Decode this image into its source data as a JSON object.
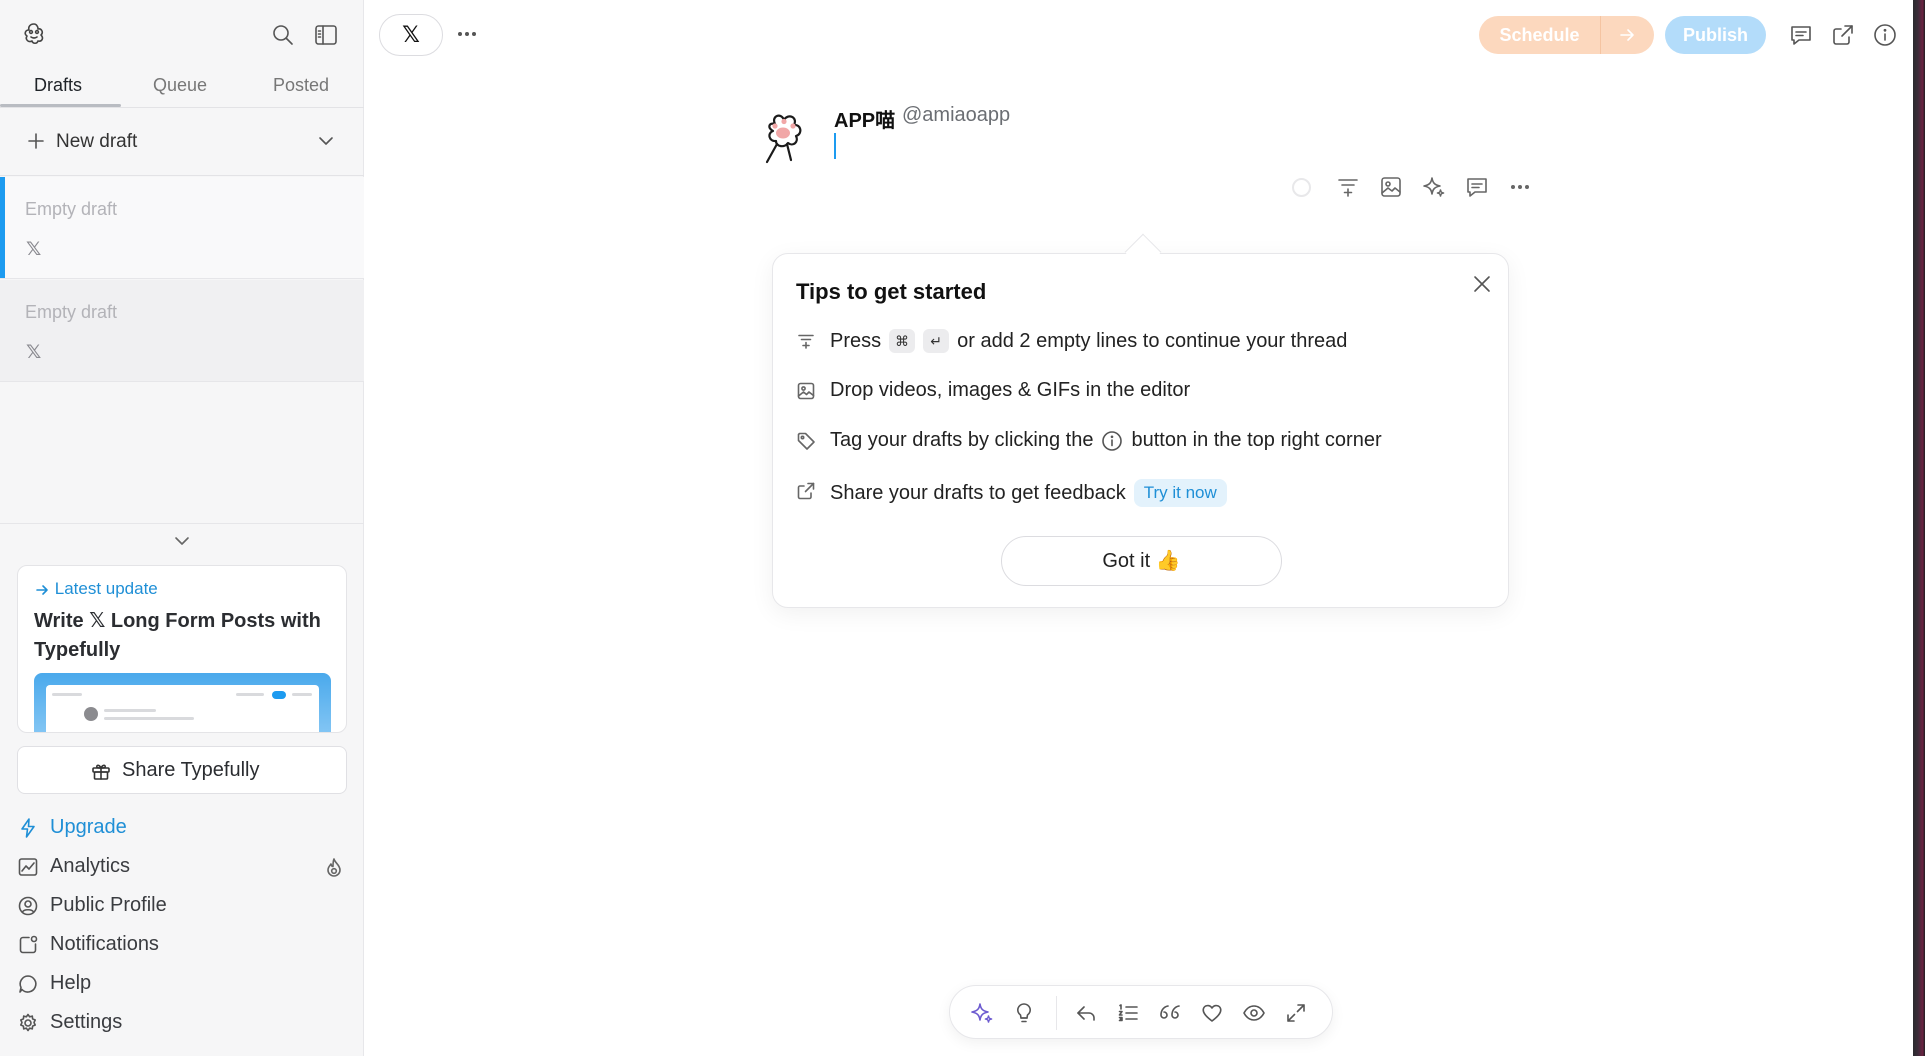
{
  "sidebar": {
    "tabs": [
      "Drafts",
      "Queue",
      "Posted"
    ],
    "new_draft_label": "New draft",
    "drafts": [
      {
        "title": "Empty draft",
        "platform": "𝕏"
      },
      {
        "title": "Empty draft",
        "platform": "𝕏"
      }
    ],
    "update": {
      "kicker": "Latest update",
      "title": "Write 𝕏 Long Form Posts with Typefully"
    },
    "share_label": "Share Typefully",
    "nav": [
      "Upgrade",
      "Analytics",
      "Public Profile",
      "Notifications",
      "Help",
      "Settings"
    ]
  },
  "topbar": {
    "platform_glyph": "𝕏",
    "schedule_label": "Schedule",
    "publish_label": "Publish"
  },
  "editor": {
    "account_name": "APP喵",
    "account_handle": "@amiaoapp"
  },
  "tips": {
    "title": "Tips to get started",
    "row1_pre": "Press",
    "row1_key1": "⌘",
    "row1_key2": "↵",
    "row1_post": "or add 2 empty lines to continue your thread",
    "row2": "Drop videos, images & GIFs in the editor",
    "row3_pre": "Tag your drafts by clicking the",
    "row3_post": "button in the top right corner",
    "row4": "Share your drafts to get feedback",
    "try_now": "Try it now",
    "got_it": "Got it 👍"
  },
  "colors": {
    "accent": "#1d9bf0",
    "schedule_bg": "#fcd8be",
    "publish_bg": "#b3dcfa"
  }
}
